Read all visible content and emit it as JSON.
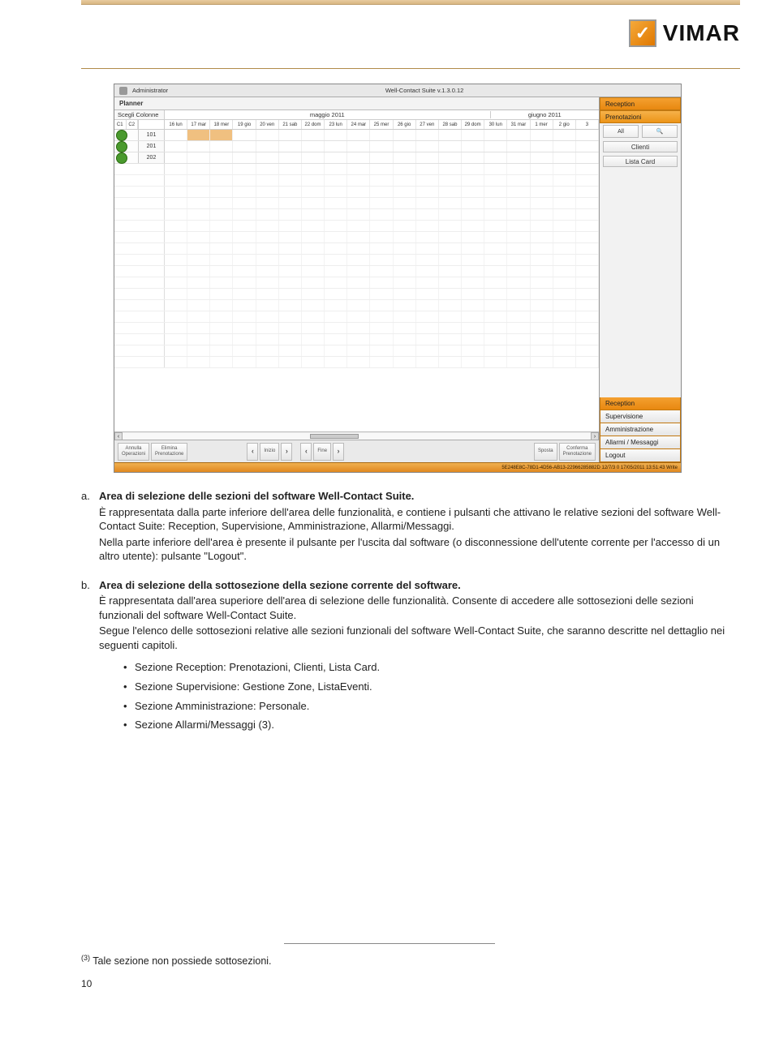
{
  "header": {
    "brand": "VIMAR"
  },
  "screenshot": {
    "titlebar": {
      "user": "Administrator",
      "title": "Well-Contact Suite v.1.3.0.12"
    },
    "planner_label": "Planner",
    "column_header": "Scegli Colonne",
    "c1": "C1",
    "c2": "C2",
    "month1": "maggio 2011",
    "month2": "giugno 2011",
    "days": [
      "16 lun",
      "17 mar",
      "18 mer",
      "19 gio",
      "20 ven",
      "21 sab",
      "22 dom",
      "23 lun",
      "24 mar",
      "25 mer",
      "26 gio",
      "27 ven",
      "28 sab",
      "29 dom",
      "30 lun",
      "31 mar",
      "1 mer",
      "2 gio",
      "3"
    ],
    "rooms": [
      "101",
      "201",
      "202"
    ],
    "footer": {
      "annulla": "Annulla\nOperazioni",
      "elimina": "Elimina\nPrenotazione",
      "inizio": "Inizio",
      "fine": "Fine",
      "sposta": "Sposta",
      "conferma": "Conferma\nPrenotazione"
    },
    "side": {
      "reception": "Reception",
      "prenotazioni": "Prenotazioni",
      "icon_all": "All",
      "clienti": "Clienti",
      "lista_card": "Lista Card",
      "bottom": {
        "reception": "Reception",
        "supervisione": "Supervisione",
        "amministrazione": "Amministrazione",
        "allarmi": "Allarmi / Messaggi",
        "logout": "Logout"
      }
    },
    "status": "5E248E8C-78D1-4D56-AB13-22966285882D 12/7/3 0 17/05/2011 13:51:43 Write"
  },
  "sections": {
    "a": {
      "title": "Area di selezione delle sezioni del software Well-Contact Suite.",
      "p1": "È rappresentata dalla parte inferiore dell'area delle funzionalità, e contiene i pulsanti che attivano le relative sezioni del software Well-Contact Suite: Reception, Supervisione, Amministrazione, Allarmi/Messaggi.",
      "p2": "Nella parte inferiore dell'area è presente il pulsante per l'uscita dal software (o disconnessione dell'utente corrente per l'accesso di un altro utente): pulsante \"Logout\"."
    },
    "b": {
      "title": "Area di selezione della sottosezione della sezione corrente del software.",
      "p1": "È rappresentata dall'area superiore dell'area di selezione delle funzionalità. Consente di accedere alle sottosezioni delle sezioni funzionali del software Well-Contact Suite.",
      "p2": "Segue l'elenco delle sottosezioni relative alle sezioni funzionali del software Well-Contact Suite, che saranno descritte nel dettaglio nei seguenti capitoli.",
      "bullets": [
        "Sezione Reception: Prenotazioni, Clienti, Lista Card.",
        "Sezione Supervisione: Gestione Zone, ListaEventi.",
        "Sezione Amministrazione: Personale.",
        "Sezione Allarmi/Messaggi (3)."
      ]
    }
  },
  "footnote": {
    "marker": "(3)",
    "text": " Tale sezione non possiede sottosezioni."
  },
  "page_number": "10"
}
